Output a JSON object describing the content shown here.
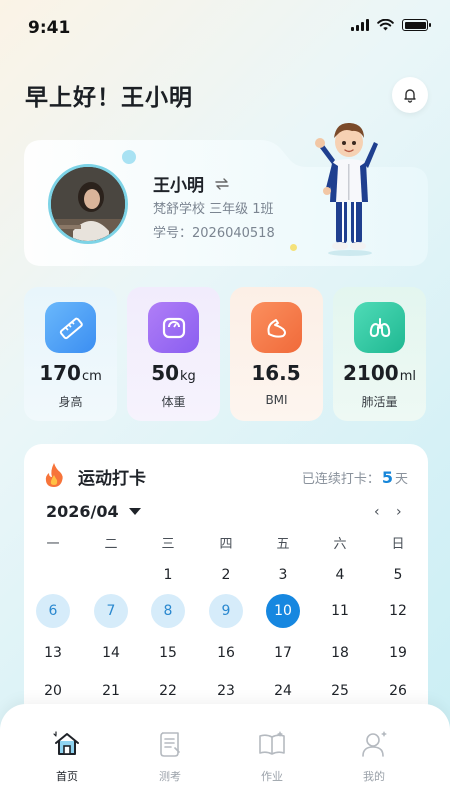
{
  "status_bar": {
    "time": "9:41"
  },
  "greeting": "早上好！王小明",
  "profile": {
    "name": "王小明",
    "school_line": "梵舒学校 三年级 1班",
    "student_id_line": "学号：2026040518"
  },
  "stats": [
    {
      "value": "170",
      "unit": "cm",
      "label": "身高",
      "icon": "ruler-icon",
      "color": "#4aa3f5"
    },
    {
      "value": "50",
      "unit": "kg",
      "label": "体重",
      "icon": "scale-icon",
      "color": "#9a6ef2"
    },
    {
      "value": "16.5",
      "unit": "",
      "label": "BMI",
      "icon": "muscle-icon",
      "color": "#f4703f"
    },
    {
      "value": "2100",
      "unit": "ml",
      "label": "肺活量",
      "icon": "lungs-icon",
      "color": "#2fc9a4"
    }
  ],
  "exercise": {
    "title": "运动打卡",
    "streak_prefix": "已连续打卡：",
    "streak_days": "5",
    "streak_suffix": "天",
    "month": "2026/04",
    "weekdays": [
      "一",
      "二",
      "三",
      "四",
      "五",
      "六",
      "日"
    ],
    "rows": [
      [
        "",
        "",
        "1",
        "2",
        "3",
        "4",
        "5"
      ],
      [
        "6",
        "7",
        "8",
        "9",
        "10",
        "11",
        "12"
      ],
      [
        "13",
        "14",
        "15",
        "16",
        "17",
        "18",
        "19"
      ],
      [
        "20",
        "21",
        "22",
        "23",
        "24",
        "25",
        "26"
      ]
    ],
    "checked_days": [
      "6",
      "7",
      "8",
      "9"
    ],
    "today": "10"
  },
  "tabs": [
    {
      "label": "首页",
      "icon": "home-icon",
      "active": true
    },
    {
      "label": "测考",
      "icon": "test-scroll-icon",
      "active": false
    },
    {
      "label": "作业",
      "icon": "book-icon",
      "active": false
    },
    {
      "label": "我的",
      "icon": "profile-icon",
      "active": false
    }
  ],
  "colors": {
    "accent": "#1687e0",
    "checked_bg": "#d6ecfa"
  }
}
